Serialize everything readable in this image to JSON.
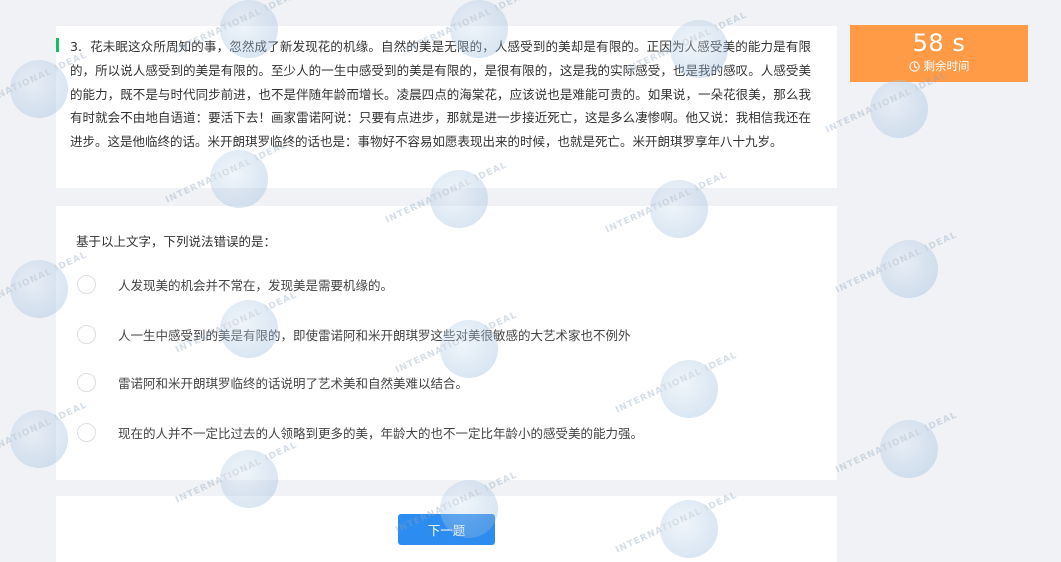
{
  "passage": {
    "number": "3.",
    "text": "花未眠这众所周知的事，忽然成了新发现花的机缘。自然的美是无限的，人感受到的美却是有限的。正因为人感受美的能力是有限的，所以说人感受到的美是有限的。至少人的一生中感受到的美是有限的，是很有限的，这是我的实际感受，也是我的感叹。人感受美的能力，既不是与时代同步前进，也不是伴随年龄而增长。凌晨四点的海棠花，应该说也是难能可贵的。如果说，一朵花很美，那么我有时就会不由地自语道：要活下去！画家雷诺阿说：只要有点进步，那就是进一步接近死亡，这是多么凄惨啊。他又说：我相信我还在进步。这是他临终的话。米开朗琪罗临终的话也是：事物好不容易如愿表现出来的时候，也就是死亡。米开朗琪罗享年八十九岁。"
  },
  "timer": {
    "value": "58 s",
    "label": "剩余时间",
    "icon": "clock-icon"
  },
  "question": {
    "stem": "基于以上文字，下列说法错误的是：",
    "options": [
      "人发现美的机会并不常在，发现美是需要机缘的。",
      "人一生中感受到的美是有限的，即使雷诺阿和米开朗琪罗这些对美很敏感的大艺术家也不例外",
      "雷诺阿和米开朗琪罗临终的话说明了艺术美和自然美难以结合。",
      "现在的人并不一定比过去的人领略到更多的美，年龄大的也不一定比年龄小的感受美的能力强。"
    ]
  },
  "footer": {
    "next_label": "下一题"
  },
  "watermark": {
    "text": "INTERNATIONAL IDEAL"
  },
  "colors": {
    "accent": "#2d8cf0",
    "timer": "#ff9b47",
    "passage_bar": "#19be6b",
    "background": "#f1f2f6"
  }
}
